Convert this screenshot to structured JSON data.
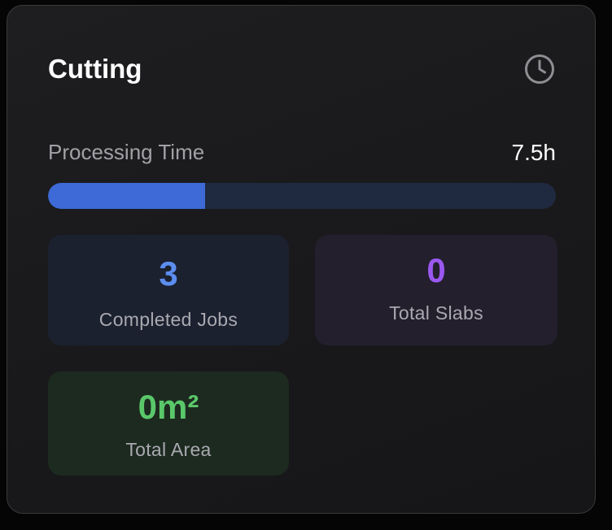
{
  "card": {
    "title": "Cutting",
    "icon": "clock-icon"
  },
  "processing": {
    "label": "Processing Time",
    "value": "7.5h",
    "progress_fraction": 0.31,
    "progress_color": "#3d6ad6",
    "track_color": "#1f2a40"
  },
  "stats": {
    "completed_jobs": {
      "value": "3",
      "label": "Completed Jobs",
      "color": "#5c8ef0"
    },
    "total_slabs": {
      "value": "0",
      "label": "Total Slabs",
      "color": "#9a58f0"
    },
    "total_area": {
      "value": "0m²",
      "label": "Total Area",
      "color": "#5ac86a"
    }
  }
}
